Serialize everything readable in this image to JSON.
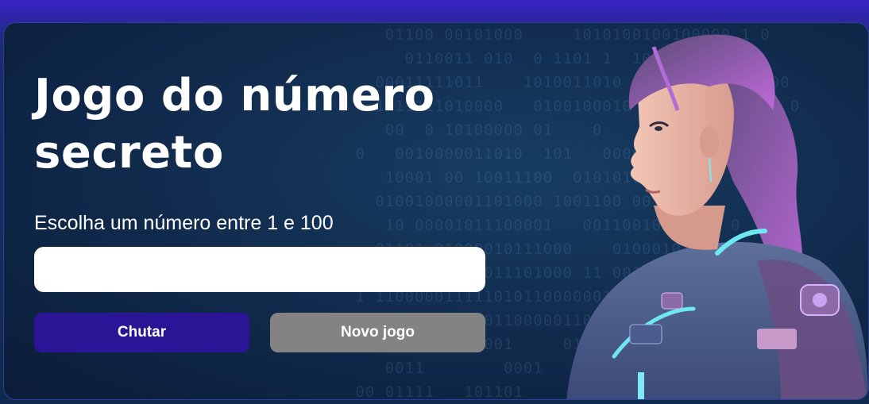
{
  "game": {
    "title": "Jogo do número secreto",
    "instruction": "Escolha um número entre 1 e 100",
    "input_value": "",
    "guess_button": "Chutar",
    "new_game_button": "Novo jogo"
  },
  "colors": {
    "primary_button": "#2a1597",
    "disabled_button": "#838383",
    "hair_accent": "#c06ad8"
  },
  "illustration": {
    "icon": "astronaut-girl-illustration"
  }
}
